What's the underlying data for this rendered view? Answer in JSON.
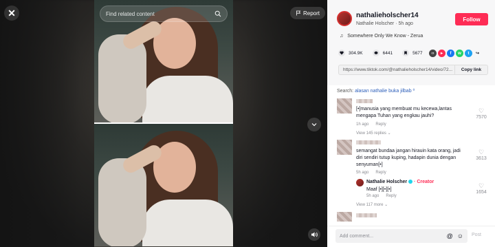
{
  "video": {
    "search_placeholder": "Find related content",
    "report_label": "Report"
  },
  "author": {
    "username": "nathalieholscher14",
    "display_name": "Nathalie Holscher",
    "posted": "5h ago",
    "follow_label": "Follow"
  },
  "music": {
    "title": "Somewhere Only We Know - Zerua"
  },
  "stats": {
    "likes": "304.9K",
    "comments": "6441",
    "saves": "5677"
  },
  "link": {
    "url": "https://www.tiktok.com/@nathalieholscher14/video/72...",
    "copy_label": "Copy link"
  },
  "related": {
    "prefix": "Search:",
    "query": "alasan nathalie buka jilbab"
  },
  "comments": [
    {
      "text_line1": "[•]manusia yang membuat mu kecewa,lantas",
      "text_line2": "mengapa Tuhan yang engkau jauhi?",
      "time": "1h ago",
      "reply_label": "Reply",
      "view_replies": "View 145 replies",
      "likes": "7570"
    },
    {
      "text_line1": "semangat bundaa jangan hirauin kata orang, jadi",
      "text_line2": "diri sendiri tutup kuping, hadapin dunia dengan",
      "text_line3": "senyuman[•]",
      "time": "5h ago",
      "reply_label": "Reply",
      "likes": "3613",
      "reply": {
        "author": "Nathalie Holscher",
        "tag": "· Creator",
        "text": "Maaf [•][•][•]",
        "time": "5h ago",
        "reply_label": "Reply",
        "likes": "1654"
      },
      "view_more": "View 117 more"
    }
  ],
  "comment_bar": {
    "placeholder": "Add comment...",
    "post_label": "Post"
  },
  "colors": {
    "follow": "#fe2c55",
    "link": "#2b5db9"
  }
}
